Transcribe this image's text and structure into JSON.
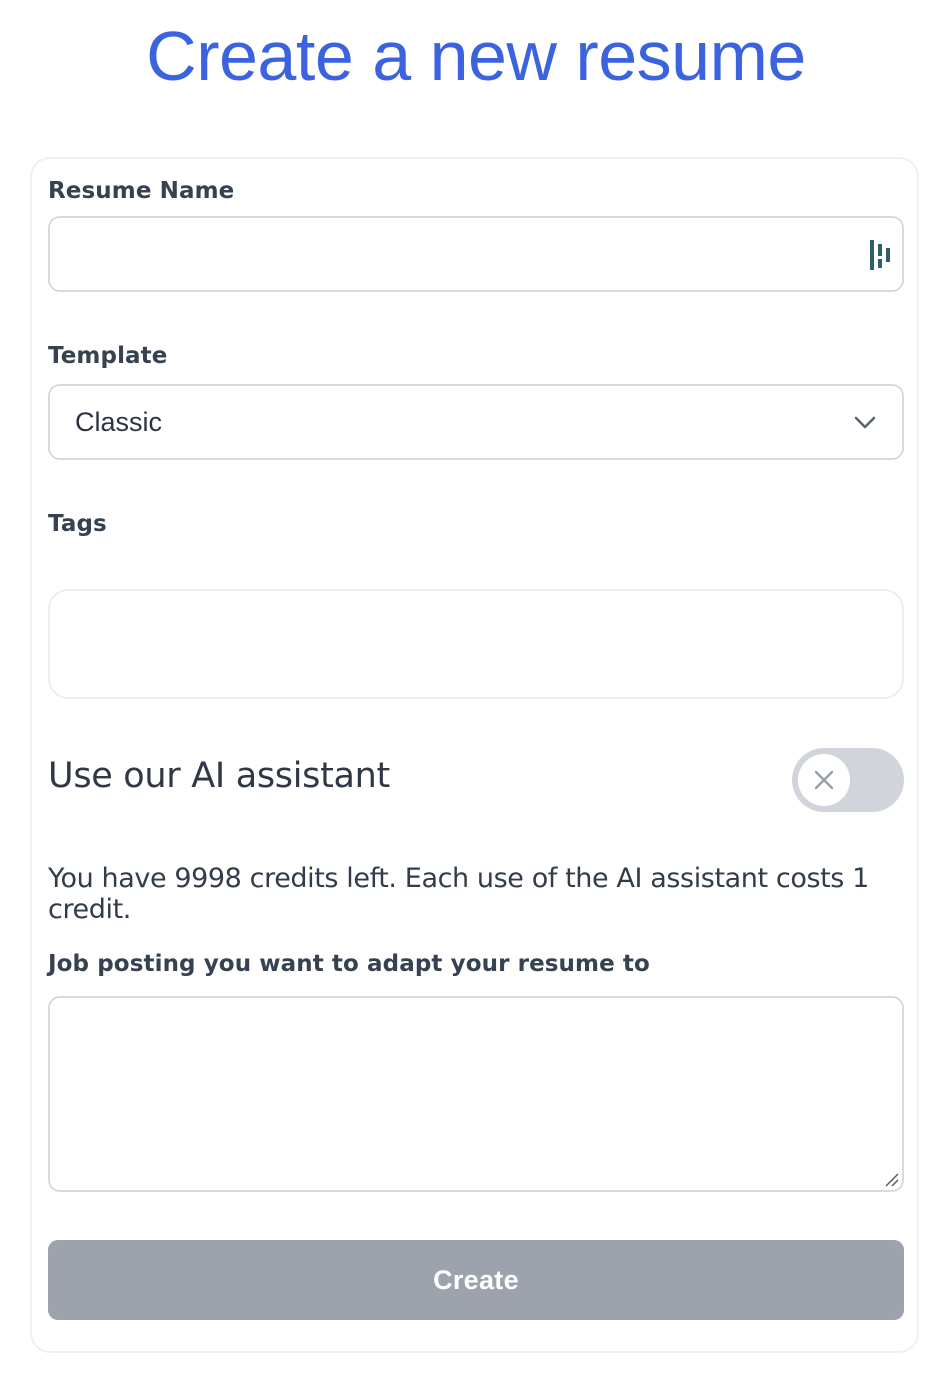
{
  "page": {
    "title": "Create a new resume"
  },
  "form": {
    "resume_name": {
      "label": "Resume Name",
      "value": "",
      "placeholder": ""
    },
    "template": {
      "label": "Template",
      "selected": "Classic"
    },
    "tags": {
      "label": "Tags"
    },
    "ai_assistant": {
      "heading": "Use our AI assistant",
      "enabled": false,
      "credits_text": "You have 9998 credits left. Each use of the AI assistant costs 1 credit."
    },
    "job_posting": {
      "label": "Job posting you want to adapt your resume to",
      "value": ""
    },
    "submit": {
      "label": "Create",
      "disabled": true
    }
  },
  "icons": {
    "password_manager": "password-manager-icon",
    "dropdown": "chevron-down-icon",
    "toggle_off": "close-icon",
    "resize": "resize-grip-icon"
  },
  "colors": {
    "title": "#3b63e0",
    "button_disabled": "#9ca3ad",
    "toggle_off": "#d1d5db",
    "text": "#364152"
  }
}
